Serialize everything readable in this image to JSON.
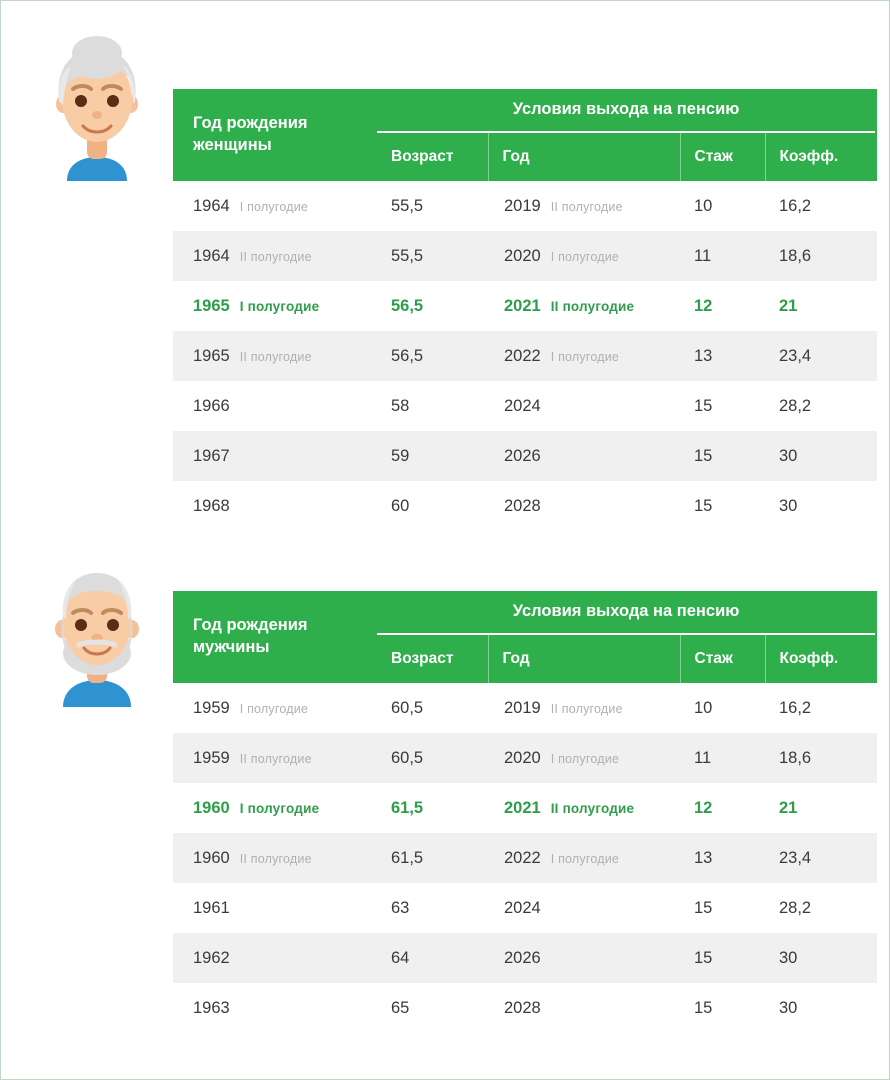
{
  "theme": {
    "header_green": "#2fae4c",
    "highlight_green": "#2e9e4a",
    "row_alt": "#f0f0f0",
    "page_border": "#c3d6cb",
    "skin": "#f4c19a",
    "hair_gray": "#d8d8d8",
    "shirt_blue": "#2f93d1"
  },
  "sections": [
    {
      "id": "women",
      "avatar_name": "elderly-woman-avatar",
      "header": {
        "birth_label": "Год рождения\nженщины",
        "birth_label_line1": "Год рождения",
        "birth_label_line2": "женщины",
        "group_label": "Условия выхода на пенсию",
        "col_age": "Возраст",
        "col_year": "Год",
        "col_experience": "Стаж",
        "col_coefficient": "Коэфф."
      },
      "rows": [
        {
          "birth_year": "1964",
          "birth_half": "I полугодие",
          "age": "55,5",
          "year": "2019",
          "year_half": "II полугодие",
          "experience": "10",
          "coefficient": "16,2",
          "highlight": false
        },
        {
          "birth_year": "1964",
          "birth_half": "II полугодие",
          "age": "55,5",
          "year": "2020",
          "year_half": "I полугодие",
          "experience": "11",
          "coefficient": "18,6",
          "highlight": false
        },
        {
          "birth_year": "1965",
          "birth_half": "I полугодие",
          "age": "56,5",
          "year": "2021",
          "year_half": "II полугодие",
          "experience": "12",
          "coefficient": "21",
          "highlight": true
        },
        {
          "birth_year": "1965",
          "birth_half": "II полугодие",
          "age": "56,5",
          "year": "2022",
          "year_half": "I полугодие",
          "experience": "13",
          "coefficient": "23,4",
          "highlight": false
        },
        {
          "birth_year": "1966",
          "birth_half": "",
          "age": "58",
          "year": "2024",
          "year_half": "",
          "experience": "15",
          "coefficient": "28,2",
          "highlight": false
        },
        {
          "birth_year": "1967",
          "birth_half": "",
          "age": "59",
          "year": "2026",
          "year_half": "",
          "experience": "15",
          "coefficient": "30",
          "highlight": false
        },
        {
          "birth_year": "1968",
          "birth_half": "",
          "age": "60",
          "year": "2028",
          "year_half": "",
          "experience": "15",
          "coefficient": "30",
          "highlight": false
        }
      ]
    },
    {
      "id": "men",
      "avatar_name": "elderly-man-avatar",
      "header": {
        "birth_label": "Год рождения\nмужчины",
        "birth_label_line1": "Год рождения",
        "birth_label_line2": "мужчины",
        "group_label": "Условия выхода на пенсию",
        "col_age": "Возраст",
        "col_year": "Год",
        "col_experience": "Стаж",
        "col_coefficient": "Коэфф."
      },
      "rows": [
        {
          "birth_year": "1959",
          "birth_half": "I полугодие",
          "age": "60,5",
          "year": "2019",
          "year_half": "II полугодие",
          "experience": "10",
          "coefficient": "16,2",
          "highlight": false
        },
        {
          "birth_year": "1959",
          "birth_half": "II полугодие",
          "age": "60,5",
          "year": "2020",
          "year_half": "I полугодие",
          "experience": "11",
          "coefficient": "18,6",
          "highlight": false
        },
        {
          "birth_year": "1960",
          "birth_half": "I полугодие",
          "age": "61,5",
          "year": "2021",
          "year_half": "II полугодие",
          "experience": "12",
          "coefficient": "21",
          "highlight": true
        },
        {
          "birth_year": "1960",
          "birth_half": "II полугодие",
          "age": "61,5",
          "year": "2022",
          "year_half": "I полугодие",
          "experience": "13",
          "coefficient": "23,4",
          "highlight": false
        },
        {
          "birth_year": "1961",
          "birth_half": "",
          "age": "63",
          "year": "2024",
          "year_half": "",
          "experience": "15",
          "coefficient": "28,2",
          "highlight": false
        },
        {
          "birth_year": "1962",
          "birth_half": "",
          "age": "64",
          "year": "2026",
          "year_half": "",
          "experience": "15",
          "coefficient": "30",
          "highlight": false
        },
        {
          "birth_year": "1963",
          "birth_half": "",
          "age": "65",
          "year": "2028",
          "year_half": "",
          "experience": "15",
          "coefficient": "30",
          "highlight": false
        }
      ]
    }
  ]
}
